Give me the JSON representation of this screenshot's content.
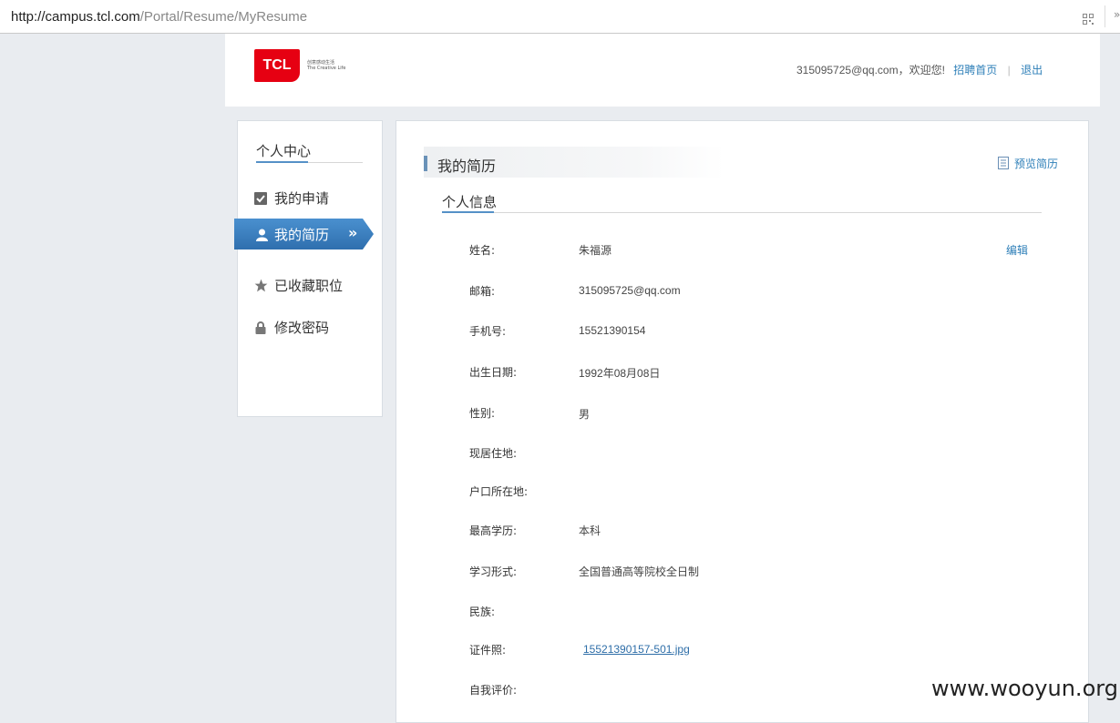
{
  "browser": {
    "url_host": "http://campus.tcl.com",
    "url_path": "/Portal/Resume/MyResume",
    "more": "»"
  },
  "header": {
    "logo_text": "TCL",
    "slogan_cn": "创意感动生活",
    "slogan_en": "The Creative Life",
    "user_email": "315095725@qq.com，欢迎您!",
    "home_link": "招聘首页",
    "divider": "|",
    "logout_link": "退出"
  },
  "sidebar": {
    "title": "个人中心",
    "items": [
      {
        "label": "我的申请",
        "icon": "checkbox-icon"
      },
      {
        "label": "我的简历",
        "icon": "person-icon",
        "active": true
      },
      {
        "label": "已收藏职位",
        "icon": "star-icon"
      },
      {
        "label": "修改密码",
        "icon": "lock-icon"
      }
    ],
    "active_chevron": "»"
  },
  "main": {
    "title": "我的简历",
    "preview_label": "预览简历",
    "section_title": "个人信息",
    "edit_label": "编辑",
    "fields": [
      {
        "label": "姓名:",
        "value": "朱福源"
      },
      {
        "label": "邮箱:",
        "value": "315095725@qq.com"
      },
      {
        "label": "手机号:",
        "value": "15521390154"
      },
      {
        "label": "出生日期:",
        "value": "1992年08月08日"
      },
      {
        "label": "性别:",
        "value": "男"
      },
      {
        "label": "现居住地:",
        "value": ""
      },
      {
        "label": "户口所在地:",
        "value": ""
      },
      {
        "label": "最高学历:",
        "value": "本科"
      },
      {
        "label": "学习形式:",
        "value": "全国普通高等院校全日制"
      },
      {
        "label": "民族:",
        "value": ""
      },
      {
        "label": "证件照:",
        "value": "15521390157-501.jpg"
      },
      {
        "label": "自我评价:",
        "value": ""
      }
    ]
  },
  "watermark": "www.wooyun.org",
  "colors": {
    "accent_blue": "#2e7fb8",
    "active_menu": "#3a7fc0",
    "logo_red": "#e60012",
    "page_bg": "#e9ecf0"
  }
}
